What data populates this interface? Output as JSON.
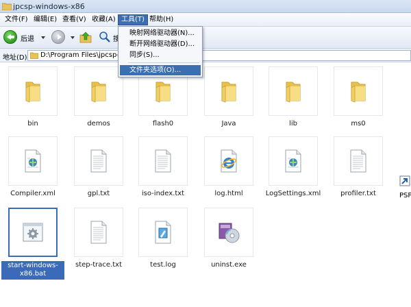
{
  "window": {
    "title": "jpcsp-windows-x86"
  },
  "menubar": {
    "items": [
      "文件(F)",
      "编辑(E)",
      "查看(V)",
      "收藏(A)",
      "工具(T)",
      "帮助(H)"
    ]
  },
  "tools_menu": {
    "items": [
      "映射网络驱动器(N)...",
      "断开网络驱动器(D)...",
      "同步(S)...",
      "文件夹选项(O)..."
    ]
  },
  "toolbar": {
    "back_label": "后退",
    "search_label": "搜"
  },
  "address": {
    "label": "地址(D)",
    "path": "D:\\Program Files\\jpcsp-wi"
  },
  "files": [
    {
      "name": "bin",
      "icon": "folder-icon"
    },
    {
      "name": "demos",
      "icon": "folder-icon"
    },
    {
      "name": "flash0",
      "icon": "folder-icon"
    },
    {
      "name": "Java",
      "icon": "folder-icon"
    },
    {
      "name": "lib",
      "icon": "folder-icon"
    },
    {
      "name": "ms0",
      "icon": "folder-icon"
    },
    {
      "name": "Compiler.xml",
      "icon": "xml-file-icon"
    },
    {
      "name": "gpl.txt",
      "icon": "text-file-icon"
    },
    {
      "name": "iso-index.txt",
      "icon": "text-file-icon"
    },
    {
      "name": "log.html",
      "icon": "html-file-icon"
    },
    {
      "name": "LogSettings.xml",
      "icon": "xml-file-icon"
    },
    {
      "name": "profiler.txt",
      "icon": "text-file-icon"
    },
    {
      "name": "start-windows-x86.bat",
      "icon": "batch-file-icon"
    },
    {
      "name": "step-trace.txt",
      "icon": "text-file-icon"
    },
    {
      "name": "test.log",
      "icon": "log-file-icon"
    },
    {
      "name": "uninst.exe",
      "icon": "installer-icon"
    }
  ],
  "partial_item": {
    "label": "PSP",
    "icon": "shortcut-icon"
  },
  "colors": {
    "selection": "#3b6bb8",
    "folder": "#f2cf63",
    "menu_highlight": "#3d6fb0"
  }
}
